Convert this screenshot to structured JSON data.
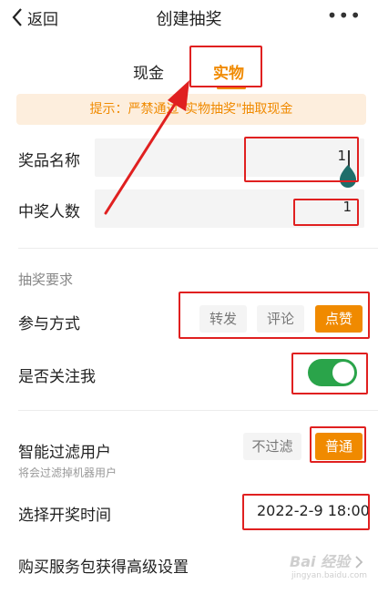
{
  "nav": {
    "back_label": "返回",
    "title": "创建抽奖",
    "more": "•••"
  },
  "tabs": [
    {
      "label": "现金",
      "active": false
    },
    {
      "label": "实物",
      "active": true
    }
  ],
  "notice": "提示：严禁通过\"实物抽奖\"抽取现金",
  "prize_name": {
    "label": "奖品名称",
    "value": "1"
  },
  "winner_count": {
    "label": "中奖人数",
    "value": "1"
  },
  "section_rules": "抽奖要求",
  "participation": {
    "label": "参与方式",
    "options": [
      {
        "label": "转发",
        "selected": false
      },
      {
        "label": "评论",
        "selected": false
      },
      {
        "label": "点赞",
        "selected": true
      }
    ]
  },
  "follow": {
    "label": "是否关注我",
    "enabled": true
  },
  "filter": {
    "label": "智能过滤用户",
    "hint": "将会过滤掉机器用户",
    "options": [
      {
        "label": "不过滤",
        "selected": false
      },
      {
        "label": "普通",
        "selected": true
      }
    ]
  },
  "draw_time": {
    "label": "选择开奖时间",
    "value": "2022-2-9 18:00"
  },
  "advanced": {
    "label": "购买服务包获得高级设置"
  },
  "watermark": {
    "brand": "Bai 经验",
    "url": "jingyan.baidu.com"
  },
  "colors": {
    "accent": "#f08a00",
    "toggle_on": "#2aa44a",
    "annotation": "#e02020"
  }
}
